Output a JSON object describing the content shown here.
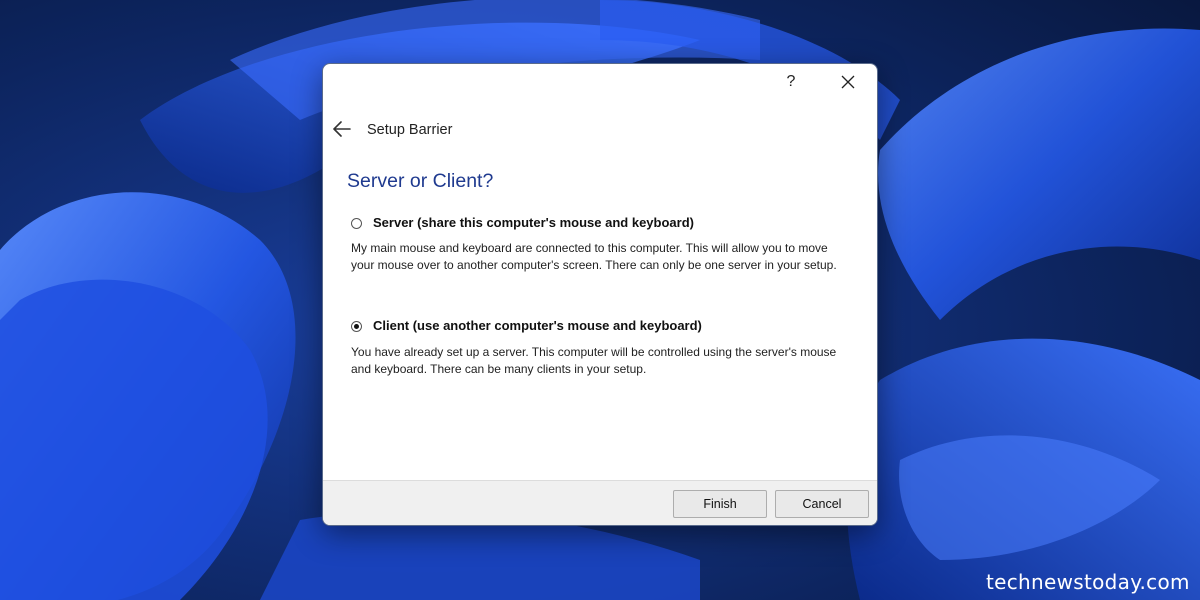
{
  "window": {
    "title": "Setup Barrier",
    "help_label": "?"
  },
  "page": {
    "heading": "Server or Client?"
  },
  "options": [
    {
      "label": "Server (share this computer's mouse and keyboard)",
      "description": "My main mouse and keyboard are connected to this computer. This will allow you to move your mouse over to another computer's screen. There can only be one server in your setup.",
      "selected": false
    },
    {
      "label": "Client (use another computer's mouse and keyboard)",
      "description": "You have already set up a server. This computer will be controlled using the server's mouse and keyboard. There can be many clients in your setup.",
      "selected": true
    }
  ],
  "buttons": {
    "finish": "Finish",
    "cancel": "Cancel"
  },
  "watermark": "technewstoday.com",
  "icons": [
    "back-arrow-icon",
    "close-icon"
  ],
  "colors": {
    "heading": "#1f3a8f",
    "wallpaper_dark": "#0b1f4a",
    "wallpaper_bloom": "#2b5ff0"
  }
}
